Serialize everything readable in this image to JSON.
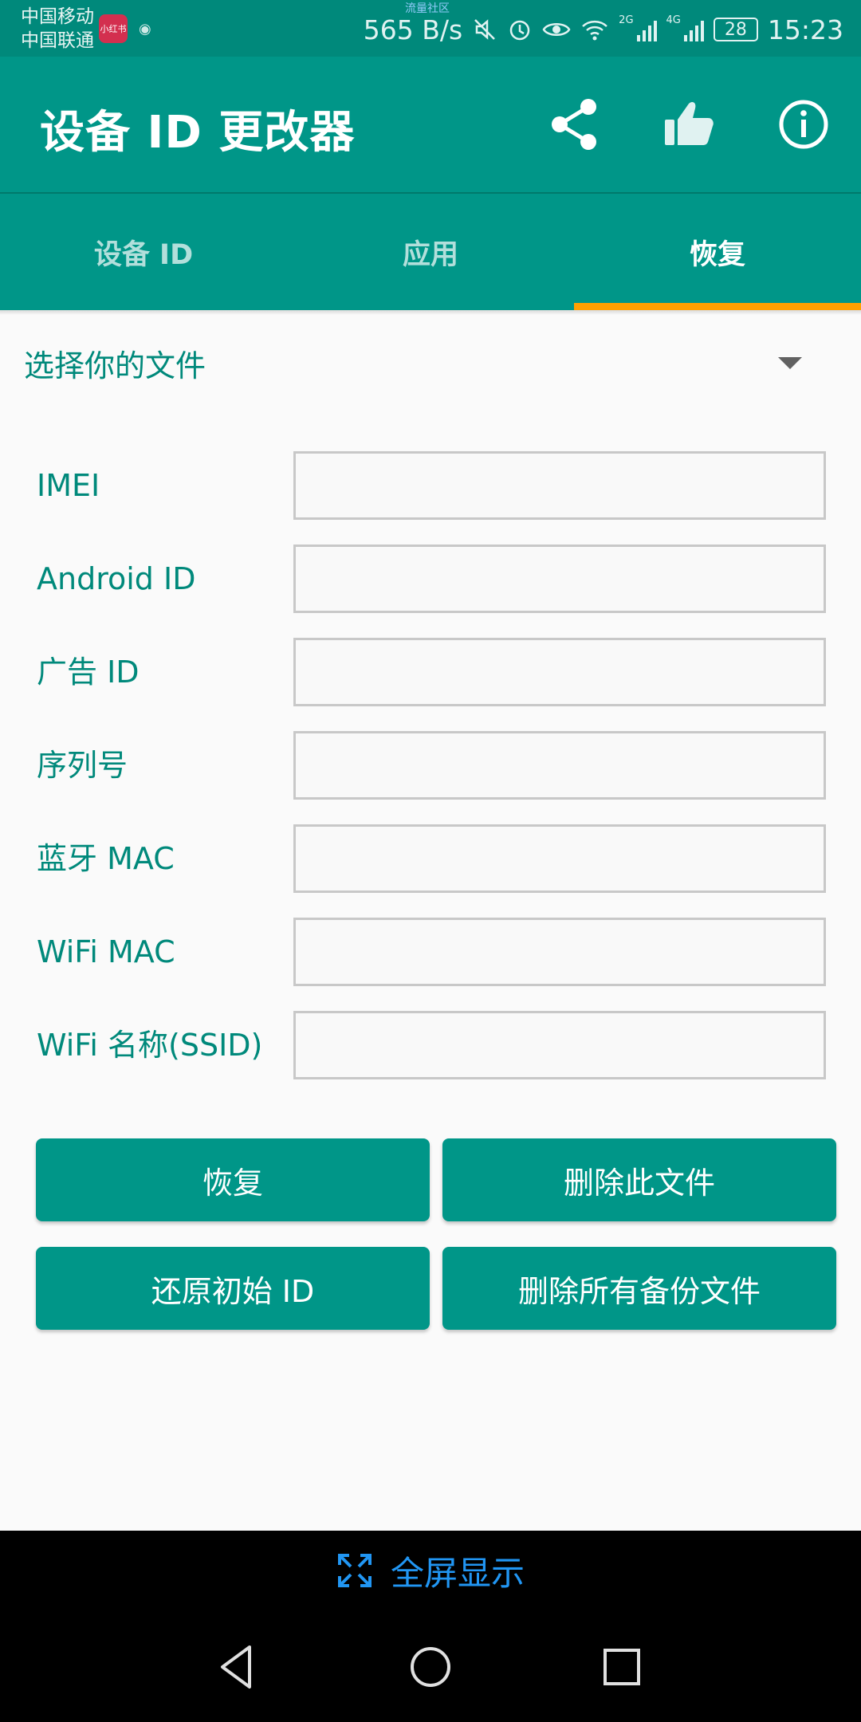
{
  "status_bar": {
    "carrier1": "中国移动",
    "carrier2": "中国联通",
    "app_badge": "小红书",
    "community": "流量社区",
    "speed": "565 B/s",
    "net_2g": "2G",
    "net_4g": "4G",
    "battery": "28",
    "time": "15:23"
  },
  "app_bar": {
    "title": "设备 ID 更改器"
  },
  "tabs": [
    {
      "label": "设备 ID",
      "active": false
    },
    {
      "label": "应用",
      "active": false
    },
    {
      "label": "恢复",
      "active": true
    }
  ],
  "file_select": {
    "label": "选择你的文件"
  },
  "fields": [
    {
      "label": "IMEI",
      "value": ""
    },
    {
      "label": "Android ID",
      "value": ""
    },
    {
      "label": "广告 ID",
      "value": ""
    },
    {
      "label": "序列号",
      "value": ""
    },
    {
      "label": "蓝牙 MAC",
      "value": ""
    },
    {
      "label": "WiFi MAC",
      "value": ""
    },
    {
      "label": "WiFi 名称(SSID)",
      "value": ""
    }
  ],
  "buttons": {
    "restore": "恢复",
    "delete_file": "删除此文件",
    "reset_original": "还原初始 ID",
    "delete_all": "删除所有备份文件"
  },
  "fullscreen": {
    "label": "全屏显示"
  },
  "colors": {
    "primary": "#009688",
    "status_bar": "#00897b",
    "accent": "#ffa000",
    "link_blue": "#2196f3"
  }
}
